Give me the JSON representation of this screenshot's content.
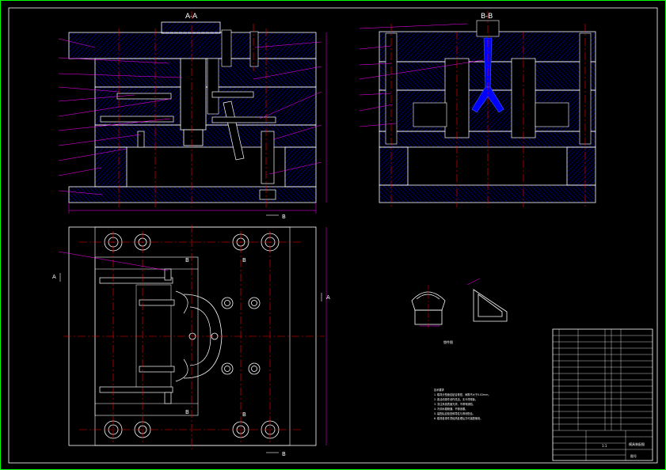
{
  "sheet": {
    "frame_color": "#00ff00",
    "line_color": "#ffffff",
    "hatch_color": "#0000ff",
    "center_color": "#ff0000",
    "leader_color": "#ff00ff",
    "dim_color": "#ff00ff",
    "runner_color": "#0000ff"
  },
  "views": {
    "front_section_label": "A-A",
    "side_section_label": "B-B",
    "top_markers": {
      "a_left": "A",
      "a_right": "A",
      "b_top_left": "B",
      "b_top_right": "B",
      "b_bottom_left": "B",
      "b_bottom_right": "B"
    },
    "section_arrow_front": "B",
    "section_arrow_plan": "B"
  },
  "notes": {
    "heading": "技术要求",
    "lines": [
      "1. 模具分型面应贴合紧密，间隙不大于0.02mm。",
      "2. 各活动零件动作灵活，无卡滞现象。",
      "3. 浇注系统表面光滑，不得有缺陷。",
      "4. 冷却水路畅通，不得渗漏。",
      "5. 装配后应检查斜导柱与滑块配合。",
      "6. 模具各零件须经热处理后方可装配使用。"
    ]
  },
  "part_label": "塑件图",
  "title_block": {
    "drawing_name": "模具装配图",
    "scale": "1:1",
    "sheet": "图号"
  }
}
